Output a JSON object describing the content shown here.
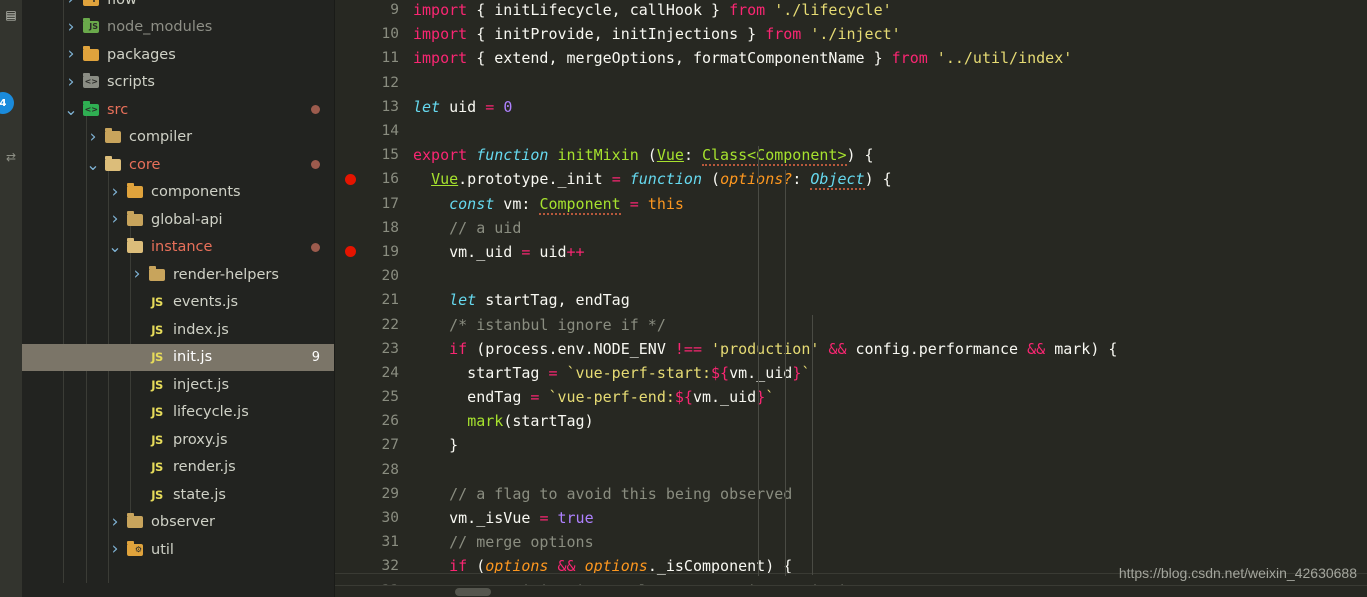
{
  "activity_bar": {
    "badge": "4",
    "icons": [
      {
        "name": "explorer-icon",
        "glyph": "❐"
      },
      {
        "name": "source-control-icon",
        "glyph": "⑂"
      }
    ]
  },
  "sidebar": {
    "items": [
      {
        "label": "flow",
        "indent": 1,
        "twisty": "collapsed",
        "icon": "folder-flow",
        "icon_kind": "orange",
        "mark": "F",
        "modified": false,
        "dim": false,
        "dot": false,
        "badge": "",
        "selected": false
      },
      {
        "label": "node_modules",
        "indent": 1,
        "twisty": "collapsed",
        "icon": "folder-node-modules",
        "icon_kind": "nodem",
        "mark": "JS",
        "modified": false,
        "dim": true,
        "dot": false,
        "badge": "",
        "selected": false
      },
      {
        "label": "packages",
        "indent": 1,
        "twisty": "collapsed",
        "icon": "folder-packages",
        "icon_kind": "orange",
        "mark": "",
        "modified": false,
        "dim": false,
        "dot": false,
        "badge": "",
        "selected": false
      },
      {
        "label": "scripts",
        "indent": 1,
        "twisty": "collapsed",
        "icon": "folder-scripts",
        "icon_kind": "gray",
        "mark": "<>",
        "modified": false,
        "dim": false,
        "dot": false,
        "badge": "",
        "selected": false
      },
      {
        "label": "src",
        "indent": 1,
        "twisty": "expanded",
        "icon": "folder-src",
        "icon_kind": "green",
        "mark": "<>",
        "modified": true,
        "dim": false,
        "dot": true,
        "badge": "",
        "selected": false
      },
      {
        "label": "compiler",
        "indent": 2,
        "twisty": "collapsed",
        "icon": "folder",
        "icon_kind": "closed",
        "mark": "",
        "modified": false,
        "dim": false,
        "dot": false,
        "badge": "",
        "selected": false
      },
      {
        "label": "core",
        "indent": 2,
        "twisty": "expanded",
        "icon": "folder",
        "icon_kind": "open",
        "mark": "",
        "modified": true,
        "dim": false,
        "dot": true,
        "badge": "",
        "selected": false
      },
      {
        "label": "components",
        "indent": 3,
        "twisty": "collapsed",
        "icon": "folder-components",
        "icon_kind": "orange",
        "mark": "",
        "modified": false,
        "dim": false,
        "dot": false,
        "badge": "",
        "selected": false
      },
      {
        "label": "global-api",
        "indent": 3,
        "twisty": "collapsed",
        "icon": "folder",
        "icon_kind": "closed",
        "mark": "",
        "modified": false,
        "dim": false,
        "dot": false,
        "badge": "",
        "selected": false
      },
      {
        "label": "instance",
        "indent": 3,
        "twisty": "expanded",
        "icon": "folder",
        "icon_kind": "open",
        "mark": "",
        "modified": true,
        "dim": false,
        "dot": true,
        "badge": "",
        "selected": false
      },
      {
        "label": "render-helpers",
        "indent": 4,
        "twisty": "collapsed",
        "icon": "folder",
        "icon_kind": "closed",
        "mark": "",
        "modified": false,
        "dim": false,
        "dot": false,
        "badge": "",
        "selected": false
      },
      {
        "label": "events.js",
        "indent": 4,
        "twisty": "none",
        "icon": "js-file",
        "icon_kind": "js",
        "mark": "JS",
        "modified": false,
        "dim": false,
        "dot": false,
        "badge": "",
        "selected": false
      },
      {
        "label": "index.js",
        "indent": 4,
        "twisty": "none",
        "icon": "js-file",
        "icon_kind": "js",
        "mark": "JS",
        "modified": false,
        "dim": false,
        "dot": false,
        "badge": "",
        "selected": false
      },
      {
        "label": "init.js",
        "indent": 4,
        "twisty": "none",
        "icon": "js-file",
        "icon_kind": "js",
        "mark": "JS",
        "modified": false,
        "dim": false,
        "dot": false,
        "badge": "9",
        "selected": true
      },
      {
        "label": "inject.js",
        "indent": 4,
        "twisty": "none",
        "icon": "js-file",
        "icon_kind": "js",
        "mark": "JS",
        "modified": false,
        "dim": false,
        "dot": false,
        "badge": "",
        "selected": false
      },
      {
        "label": "lifecycle.js",
        "indent": 4,
        "twisty": "none",
        "icon": "js-file",
        "icon_kind": "js",
        "mark": "JS",
        "modified": false,
        "dim": false,
        "dot": false,
        "badge": "",
        "selected": false
      },
      {
        "label": "proxy.js",
        "indent": 4,
        "twisty": "none",
        "icon": "js-file",
        "icon_kind": "js",
        "mark": "JS",
        "modified": false,
        "dim": false,
        "dot": false,
        "badge": "",
        "selected": false
      },
      {
        "label": "render.js",
        "indent": 4,
        "twisty": "none",
        "icon": "js-file",
        "icon_kind": "js",
        "mark": "JS",
        "modified": false,
        "dim": false,
        "dot": false,
        "badge": "",
        "selected": false
      },
      {
        "label": "state.js",
        "indent": 4,
        "twisty": "none",
        "icon": "js-file",
        "icon_kind": "js",
        "mark": "JS",
        "modified": false,
        "dim": false,
        "dot": false,
        "badge": "",
        "selected": false
      },
      {
        "label": "observer",
        "indent": 3,
        "twisty": "collapsed",
        "icon": "folder",
        "icon_kind": "closed",
        "mark": "",
        "modified": false,
        "dim": false,
        "dot": false,
        "badge": "",
        "selected": false
      },
      {
        "label": "util",
        "indent": 3,
        "twisty": "collapsed",
        "icon": "folder-util",
        "icon_kind": "orange",
        "mark": "⚙",
        "modified": false,
        "dim": false,
        "dot": false,
        "badge": "",
        "selected": false
      }
    ]
  },
  "editor": {
    "first_line": 9,
    "breakpoints": [
      16,
      19
    ],
    "lines": [
      {
        "n": 9,
        "tokens": [
          {
            "t": "import",
            "c": "kw"
          },
          {
            "t": " { initLifecycle, callHook } ",
            "c": "plain"
          },
          {
            "t": "from",
            "c": "kw"
          },
          {
            "t": " './lifecycle'",
            "c": "str"
          }
        ]
      },
      {
        "n": 10,
        "tokens": [
          {
            "t": "import",
            "c": "kw"
          },
          {
            "t": " { initProvide, initInjections } ",
            "c": "plain"
          },
          {
            "t": "from",
            "c": "kw"
          },
          {
            "t": " './inject'",
            "c": "str"
          }
        ]
      },
      {
        "n": 11,
        "tokens": [
          {
            "t": "import",
            "c": "kw"
          },
          {
            "t": " { extend, mergeOptions, formatComponentName } ",
            "c": "plain"
          },
          {
            "t": "from",
            "c": "kw"
          },
          {
            "t": " '../util/index'",
            "c": "str"
          }
        ]
      },
      {
        "n": 12,
        "tokens": []
      },
      {
        "n": 13,
        "tokens": [
          {
            "t": "let",
            "c": "ital"
          },
          {
            "t": " uid ",
            "c": "plain"
          },
          {
            "t": "=",
            "c": "op"
          },
          {
            "t": " ",
            "c": "plain"
          },
          {
            "t": "0",
            "c": "num"
          }
        ]
      },
      {
        "n": 14,
        "tokens": []
      },
      {
        "n": 15,
        "tokens": [
          {
            "t": "export",
            "c": "kw"
          },
          {
            "t": " ",
            "c": "plain"
          },
          {
            "t": "function",
            "c": "ital"
          },
          {
            "t": " ",
            "c": "plain"
          },
          {
            "t": "initMixin",
            "c": "fn"
          },
          {
            "t": " (",
            "c": "plain"
          },
          {
            "t": "Vue",
            "c": "ugreen"
          },
          {
            "t": ": ",
            "c": "plain"
          },
          {
            "t": "Class<Component>",
            "c": "fn-squig"
          },
          {
            "t": ") {",
            "c": "plain"
          }
        ]
      },
      {
        "n": 16,
        "tokens": [
          {
            "t": "  ",
            "c": "plain"
          },
          {
            "t": "Vue",
            "c": "ugreen"
          },
          {
            "t": ".prototype._init ",
            "c": "plain"
          },
          {
            "t": "=",
            "c": "op"
          },
          {
            "t": " ",
            "c": "plain"
          },
          {
            "t": "function",
            "c": "ital"
          },
          {
            "t": " (",
            "c": "plain"
          },
          {
            "t": "options?",
            "c": "param"
          },
          {
            "t": ": ",
            "c": "plain"
          },
          {
            "t": "Object",
            "c": "ital-squig"
          },
          {
            "t": ") {",
            "c": "plain"
          }
        ]
      },
      {
        "n": 17,
        "tokens": [
          {
            "t": "    ",
            "c": "plain"
          },
          {
            "t": "const",
            "c": "ital"
          },
          {
            "t": " vm",
            "c": "plain"
          },
          {
            "t": ": ",
            "c": "plain"
          },
          {
            "t": "Component",
            "c": "fn-squig"
          },
          {
            "t": " ",
            "c": "plain"
          },
          {
            "t": "=",
            "c": "op"
          },
          {
            "t": " ",
            "c": "plain"
          },
          {
            "t": "this",
            "c": "this"
          }
        ]
      },
      {
        "n": 18,
        "tokens": [
          {
            "t": "    // a uid",
            "c": "com"
          }
        ]
      },
      {
        "n": 19,
        "tokens": [
          {
            "t": "    vm._uid ",
            "c": "plain"
          },
          {
            "t": "=",
            "c": "op"
          },
          {
            "t": " uid",
            "c": "plain"
          },
          {
            "t": "++",
            "c": "op"
          }
        ]
      },
      {
        "n": 20,
        "tokens": []
      },
      {
        "n": 21,
        "tokens": [
          {
            "t": "    ",
            "c": "plain"
          },
          {
            "t": "let",
            "c": "ital"
          },
          {
            "t": " startTag, endTag",
            "c": "plain"
          }
        ]
      },
      {
        "n": 22,
        "tokens": [
          {
            "t": "    /* istanbul ignore if */",
            "c": "com"
          }
        ]
      },
      {
        "n": 23,
        "tokens": [
          {
            "t": "    ",
            "c": "plain"
          },
          {
            "t": "if",
            "c": "kw"
          },
          {
            "t": " (process.env.NODE_ENV ",
            "c": "plain"
          },
          {
            "t": "!==",
            "c": "op"
          },
          {
            "t": " ",
            "c": "plain"
          },
          {
            "t": "'production'",
            "c": "str"
          },
          {
            "t": " ",
            "c": "plain"
          },
          {
            "t": "&&",
            "c": "op"
          },
          {
            "t": " config.performance ",
            "c": "plain"
          },
          {
            "t": "&&",
            "c": "op"
          },
          {
            "t": " mark) {",
            "c": "plain"
          }
        ]
      },
      {
        "n": 24,
        "tokens": [
          {
            "t": "      startTag ",
            "c": "plain"
          },
          {
            "t": "=",
            "c": "op"
          },
          {
            "t": " `vue-perf-start:",
            "c": "str"
          },
          {
            "t": "${",
            "c": "op"
          },
          {
            "t": "vm._uid",
            "c": "plain"
          },
          {
            "t": "}",
            "c": "op"
          },
          {
            "t": "`",
            "c": "str"
          }
        ]
      },
      {
        "n": 25,
        "tokens": [
          {
            "t": "      endTag ",
            "c": "plain"
          },
          {
            "t": "=",
            "c": "op"
          },
          {
            "t": " `vue-perf-end:",
            "c": "str"
          },
          {
            "t": "${",
            "c": "op"
          },
          {
            "t": "vm._uid",
            "c": "plain"
          },
          {
            "t": "}",
            "c": "op"
          },
          {
            "t": "`",
            "c": "str"
          }
        ]
      },
      {
        "n": 26,
        "tokens": [
          {
            "t": "      ",
            "c": "plain"
          },
          {
            "t": "mark",
            "c": "fn"
          },
          {
            "t": "(startTag)",
            "c": "plain"
          }
        ]
      },
      {
        "n": 27,
        "tokens": [
          {
            "t": "    }",
            "c": "plain"
          }
        ]
      },
      {
        "n": 28,
        "tokens": []
      },
      {
        "n": 29,
        "tokens": [
          {
            "t": "    // a flag to avoid this being observed",
            "c": "com"
          }
        ]
      },
      {
        "n": 30,
        "tokens": [
          {
            "t": "    vm._isVue ",
            "c": "plain"
          },
          {
            "t": "=",
            "c": "op"
          },
          {
            "t": " ",
            "c": "plain"
          },
          {
            "t": "true",
            "c": "num"
          }
        ]
      },
      {
        "n": 31,
        "tokens": [
          {
            "t": "    // merge options",
            "c": "com"
          }
        ]
      },
      {
        "n": 32,
        "tokens": [
          {
            "t": "    ",
            "c": "plain"
          },
          {
            "t": "if",
            "c": "kw"
          },
          {
            "t": " (",
            "c": "plain"
          },
          {
            "t": "options",
            "c": "param"
          },
          {
            "t": " ",
            "c": "plain"
          },
          {
            "t": "&&",
            "c": "op"
          },
          {
            "t": " ",
            "c": "plain"
          },
          {
            "t": "options",
            "c": "param"
          },
          {
            "t": "._isComponent) {",
            "c": "plain"
          }
        ]
      },
      {
        "n": 33,
        "tokens": [
          {
            "t": "      // optimize internal component instantiation",
            "c": "com"
          }
        ]
      }
    ]
  },
  "watermark": {
    "text": "https://blog.csdn.net/weixin_42630688"
  },
  "colors": {
    "editor_bg": "#272822",
    "sidebar_bg": "#222320",
    "activity_bg": "#33342e",
    "selection_bg": "#7b7568",
    "breakpoint": "#e51400",
    "badge_blue": "#1a8bdc",
    "modified_fg": "#e8705a",
    "keyword": "#f92672",
    "string": "#e6db74",
    "comment": "#8a8d80",
    "function": "#a6e22e",
    "type_italic": "#66d9ef",
    "number": "#ae81ff",
    "param": "#fd971f"
  }
}
